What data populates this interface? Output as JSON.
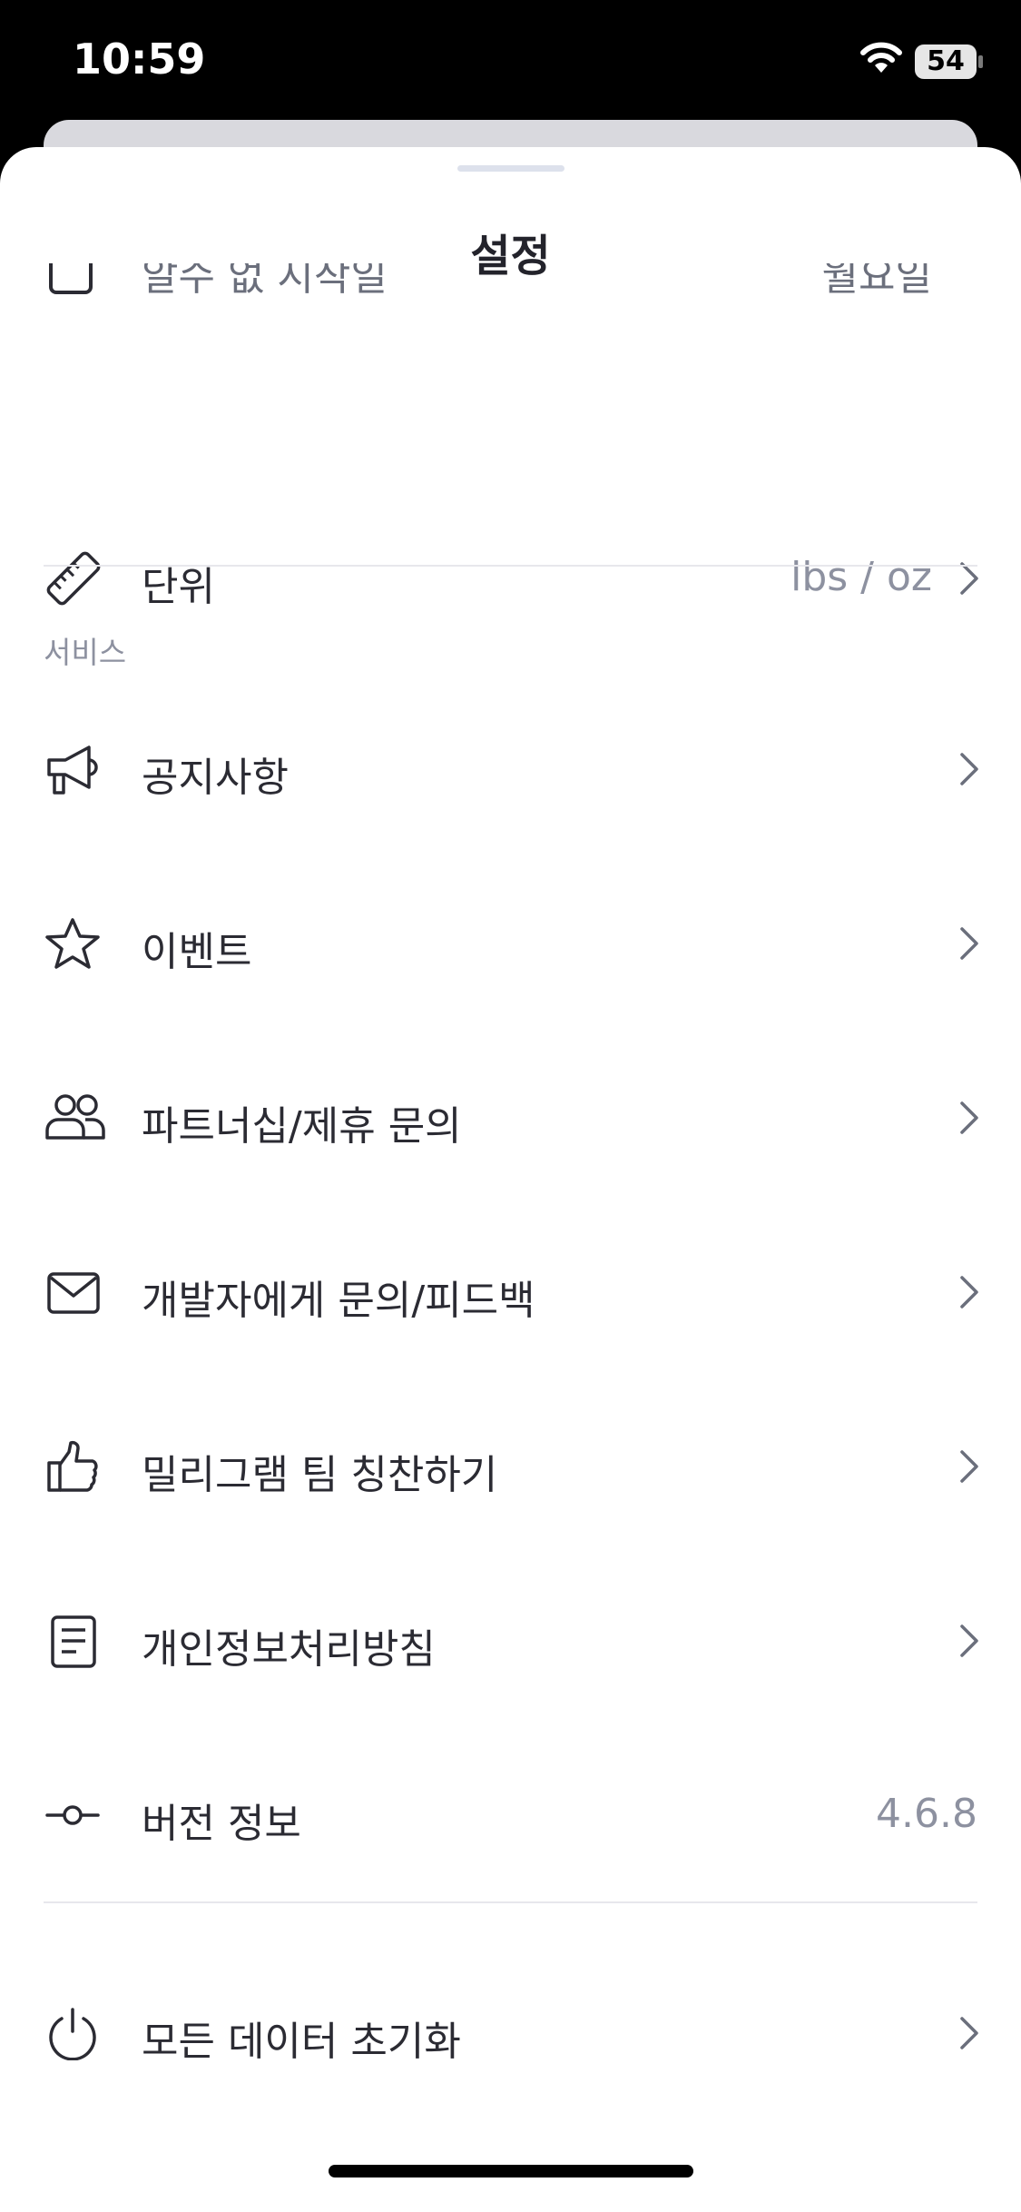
{
  "status_bar": {
    "time": "10:59",
    "battery": "54"
  },
  "sheet": {
    "title": "설정"
  },
  "settings": {
    "cut_row": {
      "label": "알수 없 시작일",
      "value": "월요일"
    },
    "unit_row": {
      "label": "단위",
      "value": "lbs / oz"
    }
  },
  "service": {
    "title": "서비스",
    "items": [
      {
        "label": "공지사항",
        "icon": "megaphone-icon"
      },
      {
        "label": "이벤트",
        "icon": "star-icon"
      },
      {
        "label": "파트너십/제휴 문의",
        "icon": "people-icon"
      },
      {
        "label": "개발자에게 문의/피드백",
        "icon": "mail-icon"
      },
      {
        "label": "밀리그램 팀 칭찬하기",
        "icon": "thumbs-up-icon"
      },
      {
        "label": "개인정보처리방침",
        "icon": "document-icon"
      }
    ],
    "version": {
      "label": "버전 정보",
      "value": "4.6.8",
      "icon": "version-icon"
    }
  },
  "reset": {
    "label": "모든 데이터 초기화",
    "icon": "power-icon"
  },
  "colors": {
    "text": "#2b2b33",
    "muted": "#8d91a0",
    "divider": "#e7e7ec"
  }
}
